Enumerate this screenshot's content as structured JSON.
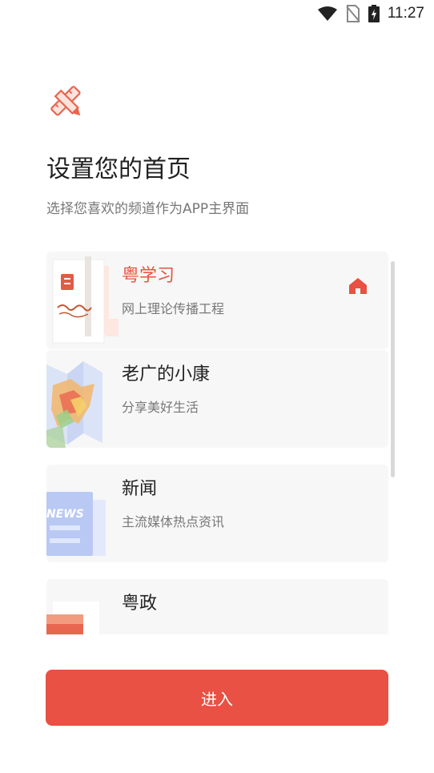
{
  "status_bar": {
    "time": "11:27",
    "icons": [
      "wifi-icon",
      "no-sim-icon",
      "battery-charging-icon"
    ]
  },
  "header": {
    "icon": "pencil-ruler-icon",
    "title": "设置您的首页",
    "subtitle": "选择您喜欢的频道作为APP主界面"
  },
  "channels": [
    {
      "name": "粤学习",
      "desc": "网上理论传播工程",
      "active": true,
      "thumb": "yue-xuexi-book-thumb"
    },
    {
      "name": "老广的小康",
      "desc": "分享美好生活",
      "active": false,
      "thumb": "map-thumb"
    },
    {
      "name": "新闻",
      "desc": "主流媒体热点资讯",
      "active": false,
      "thumb": "news-thumb",
      "thumb_text": "NEWS"
    },
    {
      "name": "粤政",
      "desc": "",
      "active": false,
      "thumb": "gov-thumb"
    }
  ],
  "enter_button": {
    "label": "进入"
  },
  "colors": {
    "accent": "#e85143",
    "active_text": "#e5533f",
    "card_bg": "#f7f7f7"
  }
}
